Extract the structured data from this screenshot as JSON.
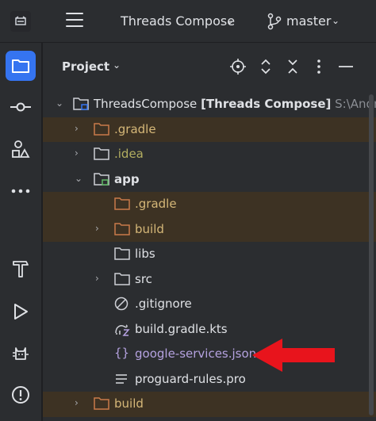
{
  "topbar": {
    "project_name": "Threads Compose",
    "branch": "master"
  },
  "panel": {
    "title": "Project"
  },
  "tree": {
    "root": {
      "name": "ThreadsCompose",
      "module": "[Threads Compose]",
      "path": "S:\\AndroidS"
    },
    "items": [
      {
        "label": ".gradle"
      },
      {
        "label": ".idea"
      },
      {
        "label": "app"
      },
      {
        "label": ".gradle"
      },
      {
        "label": "build"
      },
      {
        "label": "libs"
      },
      {
        "label": "src"
      },
      {
        "label": ".gitignore"
      },
      {
        "label": "build.gradle.kts"
      },
      {
        "label": "google-services.json"
      },
      {
        "label": "proguard-rules.pro"
      },
      {
        "label": "build"
      }
    ]
  },
  "colors": {
    "accent": "#3574f0",
    "excluded_bg": "#3d3223",
    "excluded_folder": "#c97a4a",
    "arrow": "#e8141c"
  }
}
